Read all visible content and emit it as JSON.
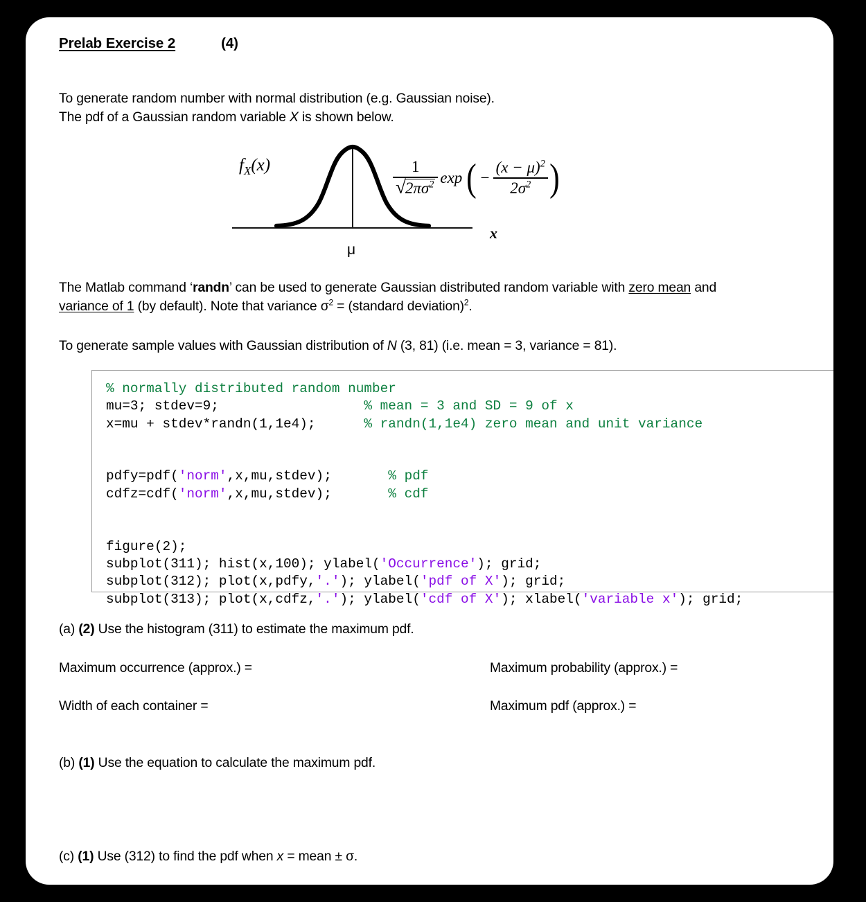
{
  "header": {
    "title": "Prelab Exercise 2",
    "points": "(4)"
  },
  "intro": {
    "line1": "To generate random number with normal distribution (e.g. Gaussian noise).",
    "line2_pre": "The pdf of a Gaussian random variable ",
    "line2_var": "X",
    "line2_post": " is shown below."
  },
  "figure": {
    "y_label": "f",
    "y_label_sub": "X",
    "y_label_arg": "(x)",
    "x_axis_label": "x",
    "mean_label": "μ",
    "equation_numerator": "1",
    "equation_sqrt_body": "2πσ",
    "equation_exp": "exp",
    "equation_frac_num": "(x − μ)",
    "equation_frac_den": "2σ",
    "equation_minus": "−",
    "equation_sup": "2"
  },
  "body": {
    "p1_a": "The Matlab command ‘",
    "p1_randn": "randn",
    "p1_b": "’ can be used to generate Gaussian distributed random variable with ",
    "p1_u1": "zero mean",
    "p1_c": " and",
    "p2_u": "variance of 1",
    "p2_a": " (by default). Note that variance σ",
    "p2_sup": "2",
    "p2_b": " = (standard deviation)",
    "p2_sup2": "2",
    "p2_c": ".",
    "p3_a": "To generate sample values with Gaussian distribution of ",
    "p3_n": "N",
    "p3_b": " (3, 81) (i.e. mean = 3, variance = 81)."
  },
  "code": {
    "lines": [
      "% normally distributed random number",
      "mu=3; stdev=9;                  % mean = 3 and SD = 9 of x",
      "x=mu + stdev*randn(1,1e4);      % randn(1,1e4) zero mean and unit variance",
      "",
      "pdfy=pdf('norm',x,mu,stdev);       % pdf",
      "cdfz=cdf('norm',x,mu,stdev);       % cdf",
      "",
      "figure(2);",
      "subplot(311); hist(x,100); ylabel('Occurrence'); grid;",
      "subplot(312); plot(x,pdfy,'.'); ylabel('pdf of X'); grid;",
      "subplot(313); plot(x,cdfz,'.'); ylabel('cdf of X'); xlabel('variable x'); grid;"
    ],
    "comment_color": "#0E8040",
    "string_color": "#8A0FE6"
  },
  "questions": {
    "a_label": "(a)",
    "a_points": "(2)",
    "a_text": " Use the histogram (311) to estimate the maximum pdf.",
    "a_field1": "Maximum occurrence (approx.) =",
    "a_field2": "Maximum probability (approx.) =",
    "a_field3": "Width of each container =",
    "a_field4": "Maximum pdf (approx.) =",
    "b_label": "(b)",
    "b_points": "(1)",
    "b_text": " Use the equation to calculate the maximum pdf.",
    "c_label": "(c)",
    "c_points": "(1)",
    "c_text_a": " Use (312) to find the pdf when ",
    "c_text_x": "x",
    "c_text_b": " = mean ± σ."
  }
}
